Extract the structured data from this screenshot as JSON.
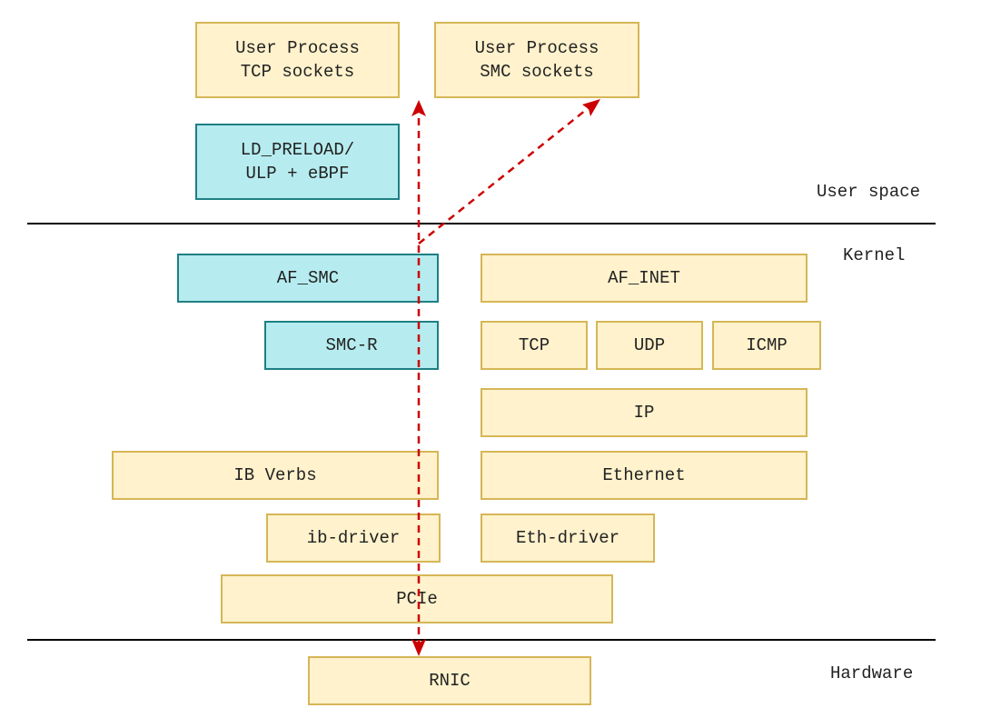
{
  "diagram": {
    "boxes": {
      "user_tcp": "User Process\nTCP sockets",
      "user_smc": "User Process\nSMC sockets",
      "ld_preload": "LD_PRELOAD/\nULP + eBPF",
      "af_smc": "AF_SMC",
      "af_inet": "AF_INET",
      "smc_r": "SMC-R",
      "tcp": "TCP",
      "udp": "UDP",
      "icmp": "ICMP",
      "ip": "IP",
      "ib_verbs": "IB Verbs",
      "ethernet": "Ethernet",
      "ib_driver": "ib-driver",
      "eth_driver": "Eth-driver",
      "pcie": "PCIe",
      "rnic": "RNIC"
    },
    "layers": {
      "user_space": "User space",
      "kernel": "Kernel",
      "hardware": "Hardware"
    },
    "colors": {
      "yellow_fill": "#fff2cc",
      "yellow_border": "#d6b656",
      "cyan_fill": "#b6ecef",
      "cyan_border": "#1e7f84",
      "arrow": "#cc0000"
    }
  }
}
